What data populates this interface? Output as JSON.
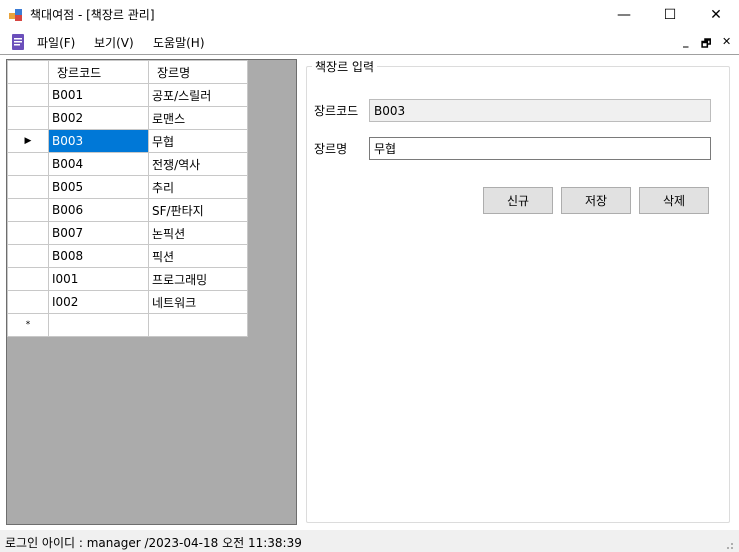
{
  "window": {
    "title": "책대여점 - [책장르 관리]",
    "minimize_glyph": "—",
    "maximize_glyph": "☐",
    "close_glyph": "✕"
  },
  "menu": {
    "items": [
      "파일(F)",
      "보기(V)",
      "도움말(H)"
    ],
    "mdi_minimize": "_",
    "mdi_restore": "🗗",
    "mdi_close": "✕"
  },
  "grid": {
    "columns": [
      "장르코드",
      "장르명"
    ],
    "rows": [
      {
        "code": "B001",
        "name": "공포/스릴러"
      },
      {
        "code": "B002",
        "name": "로맨스"
      },
      {
        "code": "B003",
        "name": "무협"
      },
      {
        "code": "B004",
        "name": "전쟁/역사"
      },
      {
        "code": "B005",
        "name": "추리"
      },
      {
        "code": "B006",
        "name": "SF/판타지"
      },
      {
        "code": "B007",
        "name": "논픽션"
      },
      {
        "code": "B008",
        "name": "픽션"
      },
      {
        "code": "I001",
        "name": "프로그래밍"
      },
      {
        "code": "I002",
        "name": "네트워크"
      }
    ],
    "selected_index": 2,
    "current_row_glyph": "▶",
    "new_row_glyph": "*"
  },
  "form": {
    "group_title": "책장르 입력",
    "code_label": "장르코드",
    "code_value": "B003",
    "name_label": "장르명",
    "name_value": "무협",
    "buttons": {
      "new": "신규",
      "save": "저장",
      "delete": "삭제"
    }
  },
  "status": {
    "text": "로그인 아이디 :  manager  /2023-04-18 오전 11:38:39"
  },
  "colors": {
    "selection": "#0078d7",
    "grid_background": "#ababab",
    "statusbar": "#f0f0f0"
  }
}
